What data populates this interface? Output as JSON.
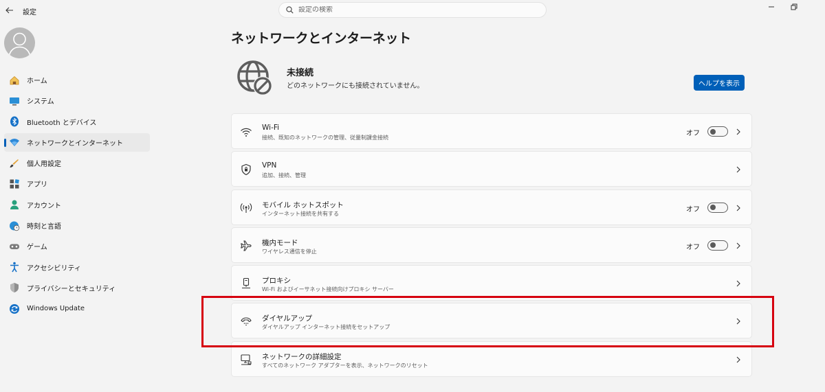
{
  "window": {
    "title": "設定",
    "minimize_icon": "minimize-icon",
    "restore_icon": "restore-icon"
  },
  "search": {
    "placeholder": "設定の検索"
  },
  "sidebar": {
    "items": [
      {
        "label": "ホーム",
        "icon": "home-icon"
      },
      {
        "label": "システム",
        "icon": "system-icon"
      },
      {
        "label": "Bluetooth とデバイス",
        "icon": "bluetooth-icon"
      },
      {
        "label": "ネットワークとインターネット",
        "icon": "wifi-icon",
        "active": true
      },
      {
        "label": "個人用設定",
        "icon": "brush-icon"
      },
      {
        "label": "アプリ",
        "icon": "apps-icon"
      },
      {
        "label": "アカウント",
        "icon": "account-icon"
      },
      {
        "label": "時刻と言語",
        "icon": "globe-clock-icon"
      },
      {
        "label": "ゲーム",
        "icon": "gamepad-icon"
      },
      {
        "label": "アクセシビリティ",
        "icon": "accessibility-icon"
      },
      {
        "label": "プライバシーとセキュリティ",
        "icon": "shield-icon"
      },
      {
        "label": "Windows Update",
        "icon": "update-icon"
      }
    ]
  },
  "main": {
    "title": "ネットワークとインターネット",
    "status": {
      "title": "未接続",
      "description": "どのネットワークにも接続されていません。",
      "icon": "globe-blocked-icon"
    },
    "help_button": "ヘルプを表示",
    "settings": [
      {
        "title": "Wi-Fi",
        "subtitle": "接続、既知のネットワークの管理、従量制課金接続",
        "state": "オフ",
        "icon": "wifi-icon"
      },
      {
        "title": "VPN",
        "subtitle": "追加、接続、管理",
        "icon": "vpn-shield-icon"
      },
      {
        "title": "モバイル ホットスポット",
        "subtitle": "インターネット接続を共有する",
        "state": "オフ",
        "icon": "hotspot-icon"
      },
      {
        "title": "機内モード",
        "subtitle": "ワイヤレス通信を停止",
        "state": "オフ",
        "icon": "airplane-icon"
      },
      {
        "title": "プロキシ",
        "subtitle": "Wi-Fi およびイーサネット接続向けプロキシ サーバー",
        "icon": "proxy-icon"
      },
      {
        "title": "ダイヤルアップ",
        "subtitle": "ダイヤルアップ インターネット接続をセットアップ",
        "icon": "dialup-icon"
      },
      {
        "title": "ネットワークの詳細設定",
        "subtitle": "すべてのネットワーク アダプターを表示、ネットワークのリセット",
        "icon": "network-pc-icon"
      }
    ]
  },
  "colors": {
    "accent": "#005fb8",
    "highlight": "#d6000f"
  }
}
